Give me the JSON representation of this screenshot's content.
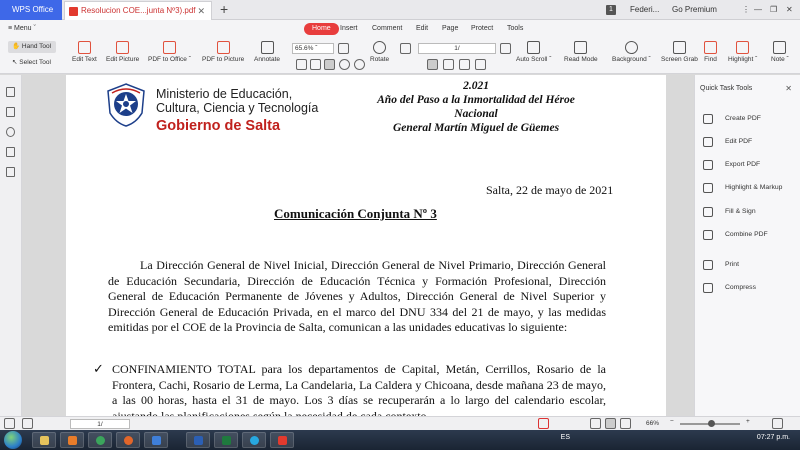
{
  "titlebar": {
    "app_tab": "WPS Office",
    "doc_tab": "Resolucion COE...junta Nº3).pdf",
    "new_tab": "+",
    "page_badge": "1",
    "user": "Federi...",
    "premium": "Go Premium",
    "window_controls": [
      "⋮",
      "—",
      "❐",
      "✕"
    ]
  },
  "menubar": {
    "menu": "Menu",
    "tabs": [
      "Home",
      "Insert",
      "Comment",
      "Edit",
      "Page",
      "Protect",
      "Tools"
    ],
    "active": "Home"
  },
  "toolbar": {
    "hand_tool": "Hand Tool",
    "select_tool": "Select Tool",
    "edit_text": "Edit Text",
    "edit_picture": "Edit Picture",
    "pdf_to_office": "PDF to Office ˇ",
    "pdf_to_picture": "PDF to Picture",
    "annotate": "Annotate",
    "zoom": "65.6%",
    "page": "1/",
    "rotate": "Rotate",
    "auto_scroll": "Auto Scroll ˇ",
    "read_mode": "Read Mode",
    "background": "Background ˇ",
    "screen_grab": "Screen Grab",
    "find": "Find",
    "highlight": "Highlight ˇ",
    "note": "Note ˇ"
  },
  "document": {
    "ministry_lines": [
      "Ministerio de Educación,",
      "Cultura, Ciencia y Tecnología"
    ],
    "gobierno": "Gobierno de Salta",
    "year_lines": [
      "2.021",
      "Año del Paso a la Inmortalidad del Héroe",
      "Nacional",
      "General Martín Miguel de Güemes"
    ],
    "date": "Salta, 22 de mayo de 2021",
    "title": "Comunicación Conjunta Nº 3",
    "paragraph1": "La Dirección General de Nivel Inicial, Dirección General de Nivel Primario, Dirección General de Educación Secundaria, Dirección de Educación Técnica y Formación Profesional, Dirección General de Educación Permanente de Jóvenes y Adultos, Dirección General de Nivel Superior y Dirección General de Educación Privada, en el marco del DNU 334 del 21 de mayo, y las medidas emitidas por el COE de la Provincia de Salta, comunican a las unidades educativas lo siguiente:",
    "check": "✓",
    "paragraph2": "CONFINAMIENTO TOTAL para los departamentos de Capital, Metán, Cerrillos, Rosario de la Frontera, Cachi, Rosario de Lerma, La Candelaria, La Caldera y Chicoana, desde mañana 23 de mayo, a las 00 horas, hasta el 31 de mayo. Los 3 días se recuperarán a lo largo del calendario escolar, ajustando las planificaciones según la necesidad de cada contexto."
  },
  "right_panel": {
    "title": "Quick Task Tools",
    "close": "✕",
    "tasks": [
      "Create PDF",
      "Edit PDF",
      "Export PDF",
      "Highlight & Markup",
      "Fill & Sign",
      "Combine PDF",
      "Print",
      "Compress"
    ]
  },
  "statusbar": {
    "page": "1/",
    "zoom": "66%"
  },
  "taskbar": {
    "language": "ES",
    "clock": "07:27 p.m."
  },
  "colors": {
    "accent": "#e83d3d",
    "app_blue": "#3e68e8",
    "gobierno_red": "#c0211d"
  }
}
